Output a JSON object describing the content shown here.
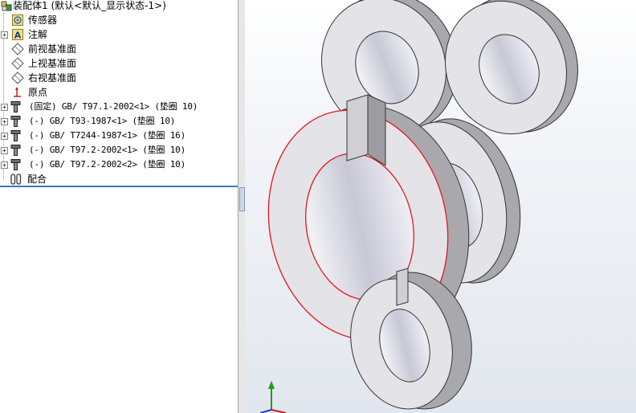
{
  "tree": {
    "root_label": "装配体1  (默认<默认_显示状态-1>)",
    "items": [
      {
        "label": "传感器",
        "icon": "sensor-icon",
        "expander": ""
      },
      {
        "label": "注解",
        "icon": "annotation-icon",
        "expander": "+"
      },
      {
        "label": "前视基准面",
        "icon": "plane-icon",
        "expander": ""
      },
      {
        "label": "上视基准面",
        "icon": "plane-icon",
        "expander": ""
      },
      {
        "label": "右视基准面",
        "icon": "plane-icon",
        "expander": ""
      },
      {
        "label": "原点",
        "icon": "origin-icon",
        "expander": ""
      },
      {
        "label": "(固定) GB/ T97.1-2002<1> (垫圈  10)",
        "icon": "part-icon",
        "expander": "+"
      },
      {
        "label": "(-) GB/ T93-1987<1> (垫圈  10)",
        "icon": "part-icon",
        "expander": "+"
      },
      {
        "label": "(-) GB/ T7244-1987<1> (垫圈  16)",
        "icon": "part-icon",
        "expander": "+"
      },
      {
        "label": "(-) GB/ T97.2-2002<1> (垫圈  10)",
        "icon": "part-icon",
        "expander": "+"
      },
      {
        "label": "(-) GB/ T97.2-2002<2> (垫圈  10)",
        "icon": "part-icon",
        "expander": "+"
      },
      {
        "label": "配合",
        "icon": "mates-icon",
        "expander": ""
      }
    ]
  },
  "colors": {
    "selection_edge": "#e8141e",
    "washer_face": "#e4e4e8",
    "washer_side": "#a9a9ad",
    "separator": "#3d78c6"
  }
}
